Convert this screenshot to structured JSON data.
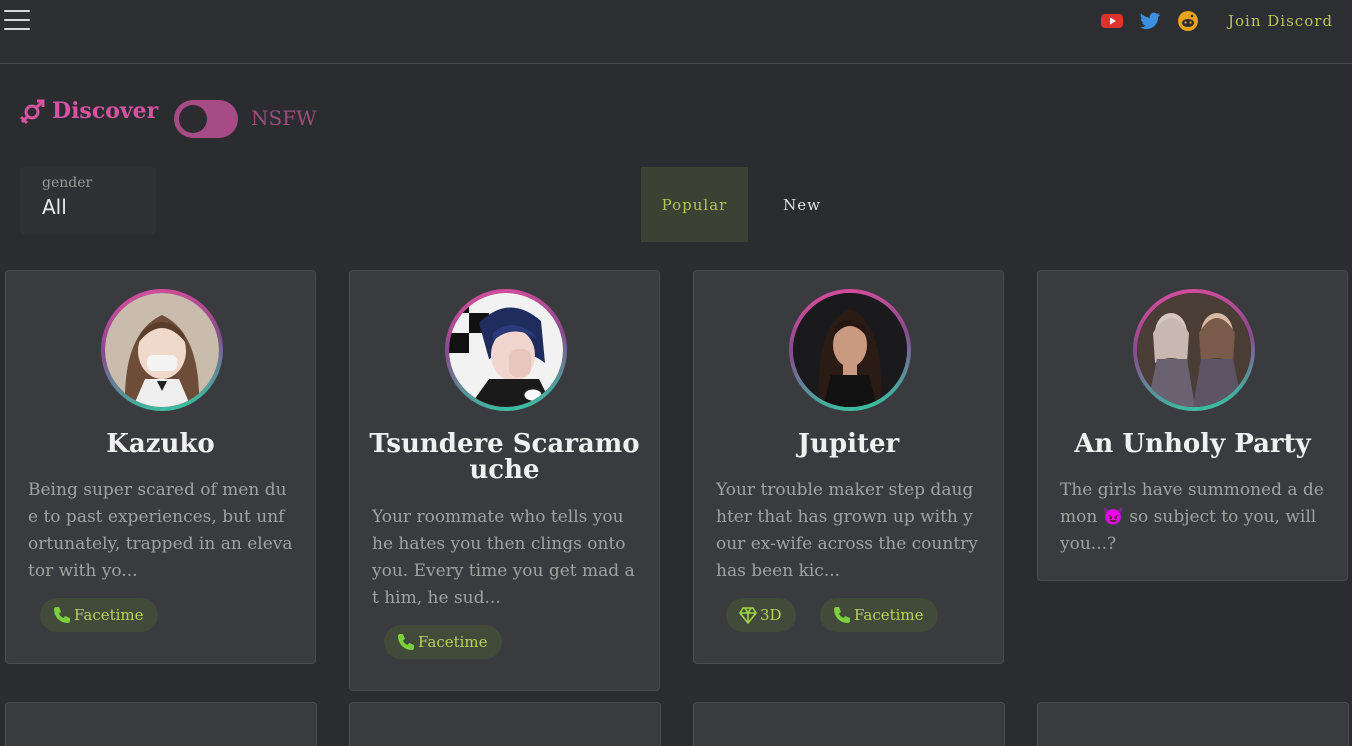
{
  "header": {
    "join_discord": "Join Discord",
    "social": [
      "youtube-icon",
      "twitter-icon",
      "reddit-icon"
    ]
  },
  "discover": {
    "title": "Discover",
    "nsfw_label": "NSFW",
    "nsfw_enabled": false
  },
  "filter": {
    "gender_label": "gender",
    "gender_value": "All"
  },
  "tabs": [
    {
      "label": "Popular",
      "active": true
    },
    {
      "label": "New",
      "active": false
    }
  ],
  "cards": [
    {
      "name": "Kazuko",
      "description": "Being super scared of men due to past experiences, but unfortunately, trapped in an elevator with yo...",
      "tags": [
        "Facetime"
      ]
    },
    {
      "name": "Tsundere Scaramouche",
      "description": "Your roommate who tells you he hates you then clings onto you. Every time you get mad at him, he sud...",
      "tags": [
        "Facetime"
      ]
    },
    {
      "name": "Jupiter",
      "description": "Your trouble maker step daughter that has grown up with your ex-wife across the country has been kic...",
      "tags": [
        "3D",
        "Facetime"
      ]
    },
    {
      "name": "An Unholy Party",
      "description": "The girls have summoned a demon 😈 so subject to you, will you...?",
      "tags": []
    }
  ],
  "colors": {
    "background": "#2b2c2f",
    "accent_pink": "#d454a3",
    "accent_green": "#b5c256",
    "card": "#3a3b3f"
  }
}
